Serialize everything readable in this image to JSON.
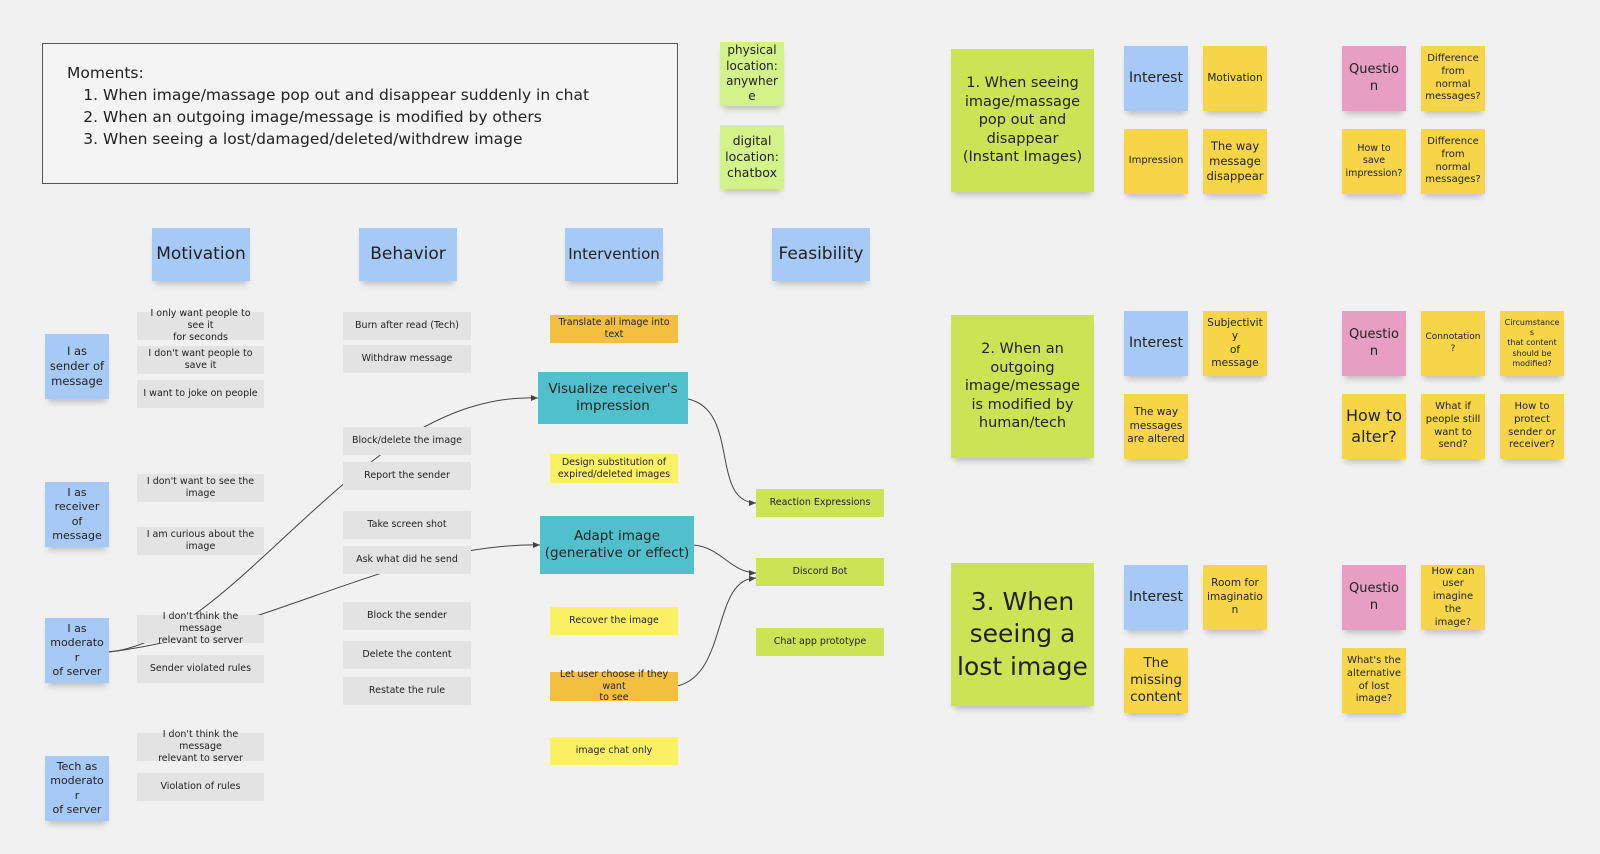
{
  "moments": {
    "heading": "Moments:",
    "items": [
      "When image/massage pop out and disappear suddenly in chat",
      "When an outgoing image/message is modified by others",
      "When seeing a lost/damaged/deleted/withdrew image"
    ]
  },
  "locations": {
    "physical": "physical\nlocation:\nanywhere",
    "digital": "digital\nlocation:\nchatbox"
  },
  "columns": {
    "motivation": "Motivation",
    "behavior": "Behavior",
    "intervention": "Intervention",
    "feasibility": "Feasibility"
  },
  "actors": {
    "sender": "I as\nsender of\nmessage",
    "receiver": "I as\nreceiver of\nmessage",
    "moderator": "I as\nmoderator\nof server",
    "tech": "Tech as\nmoderator\nof server"
  },
  "motivations": [
    "I only want people to see it\nfor seconds",
    "I don't want people to save it",
    "I want to joke on people",
    "I don't want to see the image",
    "I am curious about the image",
    "I don't think the message\nrelevant to server",
    "Sender violated rules",
    "I don't think the message\nrelevant to server",
    "Violation of rules"
  ],
  "behaviors": [
    "Burn after read (Tech)",
    "Withdraw message",
    "Block/delete the image",
    "Report the sender",
    "Take screen shot",
    "Ask what did he send",
    "Block the sender",
    "Delete the content",
    "Restate the rule"
  ],
  "interventions": {
    "translate": "Translate all image into text",
    "visualize": "Visualize receiver's\nimpression",
    "design_substitution": "Design substitution of\nexpired/deleted images",
    "adapt": "Adapt image\n(generative or effect)",
    "recover": "Recover the image",
    "let_user_choose": "Let user choose if they want\nto see",
    "image_chat": "image chat only"
  },
  "feasibility": {
    "reaction": "Reaction Expressions",
    "discord": "Discord Bot",
    "chat_app": "Chat app prototype"
  },
  "clusters": {
    "c1": {
      "moment": "1. When seeing\nimage/massage\npop out and\ndisappear\n(Instant Images)",
      "interest": "Interest",
      "motivation": "Motivation",
      "impression": "Impression",
      "way": "The way\nmessage\ndisappear",
      "question": "Question",
      "q1": "Difference\nfrom\nnormal\nmessages?",
      "q2": "How to save\nimpression?",
      "q3": "Difference\nfrom\nnormal\nmessages?"
    },
    "c2": {
      "moment": "2. When an\noutgoing\nimage/message\nis modified by\nhuman/tech",
      "interest": "Interest",
      "subjectivity": "Subjectivity\nof message",
      "way": "The way\nmessages\nare altered",
      "question": "Question",
      "connotation": "Connotation?",
      "circumstances": "Circumstances\nthat content\nshould be\nmodified?",
      "how_alter": "How to\nalter?",
      "what_if": "What if\npeople still\nwant to\nsend?",
      "protect": "How to\nprotect\nsender or\nreceiver?"
    },
    "c3": {
      "moment": "3. When\nseeing a\nlost image",
      "interest": "Interest",
      "room": "Room for\nimagination",
      "missing": "The\nmissing\ncontent",
      "question": "Question",
      "imagine": "How can\nuser\nimagine the\nimage?",
      "alternative": "What's the\nalternative\nof lost\nimage?"
    }
  },
  "colors": {
    "blue": "#a6c9f5",
    "yellow": "#f7d548",
    "orange": "#f2c03e",
    "bright_yellow": "#fbf063",
    "lime": "#cde356",
    "pale_green": "#d4f28a",
    "pink": "#e69ec3",
    "teal": "#4fc0cc",
    "gray_card": "#e3e3e3"
  }
}
